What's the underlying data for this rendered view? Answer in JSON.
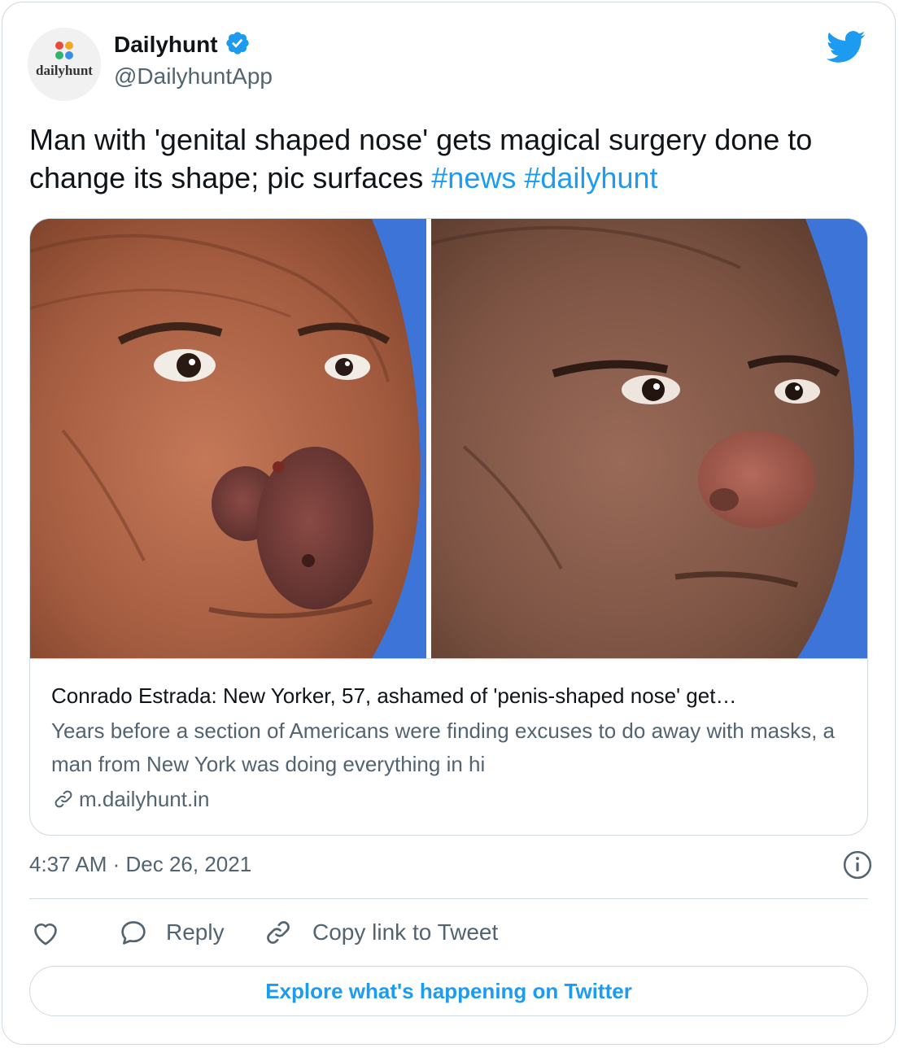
{
  "colors": {
    "accent": "#1d9bf0",
    "text_primary": "#0f1419",
    "text_secondary": "#536471",
    "border": "#cfd9de"
  },
  "author": {
    "display_name": "Dailyhunt",
    "handle": "@DailyhuntApp",
    "avatar_text": "dailyhunt",
    "verified_icon": "verified-badge-icon"
  },
  "header": {
    "brand_icon": "twitter-bird-icon"
  },
  "tweet": {
    "text": "Man with 'genital shaped nose' gets magical surgery done to change its shape; pic surfaces ",
    "hashtags": [
      "#news",
      "#dailyhunt"
    ]
  },
  "link_card": {
    "title": "Conrado Estrada: New Yorker, 57, ashamed of 'penis-shaped nose' get…",
    "description": "Years before a section of Americans were finding excuses to do away with masks, a man from New York was doing everything in hi",
    "domain": "m.dailyhunt.in",
    "domain_icon": "link-icon",
    "images": [
      {
        "icon": "before-photo"
      },
      {
        "icon": "after-photo"
      }
    ]
  },
  "meta": {
    "timestamp": "4:37 AM · Dec 26, 2021",
    "info_icon": "info-icon"
  },
  "actions": {
    "like_icon": "heart-icon",
    "reply_label": "Reply",
    "reply_icon": "reply-bubble-icon",
    "copy_label": "Copy link to Tweet",
    "copy_icon": "link-icon"
  },
  "explore": {
    "label": "Explore what's happening on Twitter"
  }
}
